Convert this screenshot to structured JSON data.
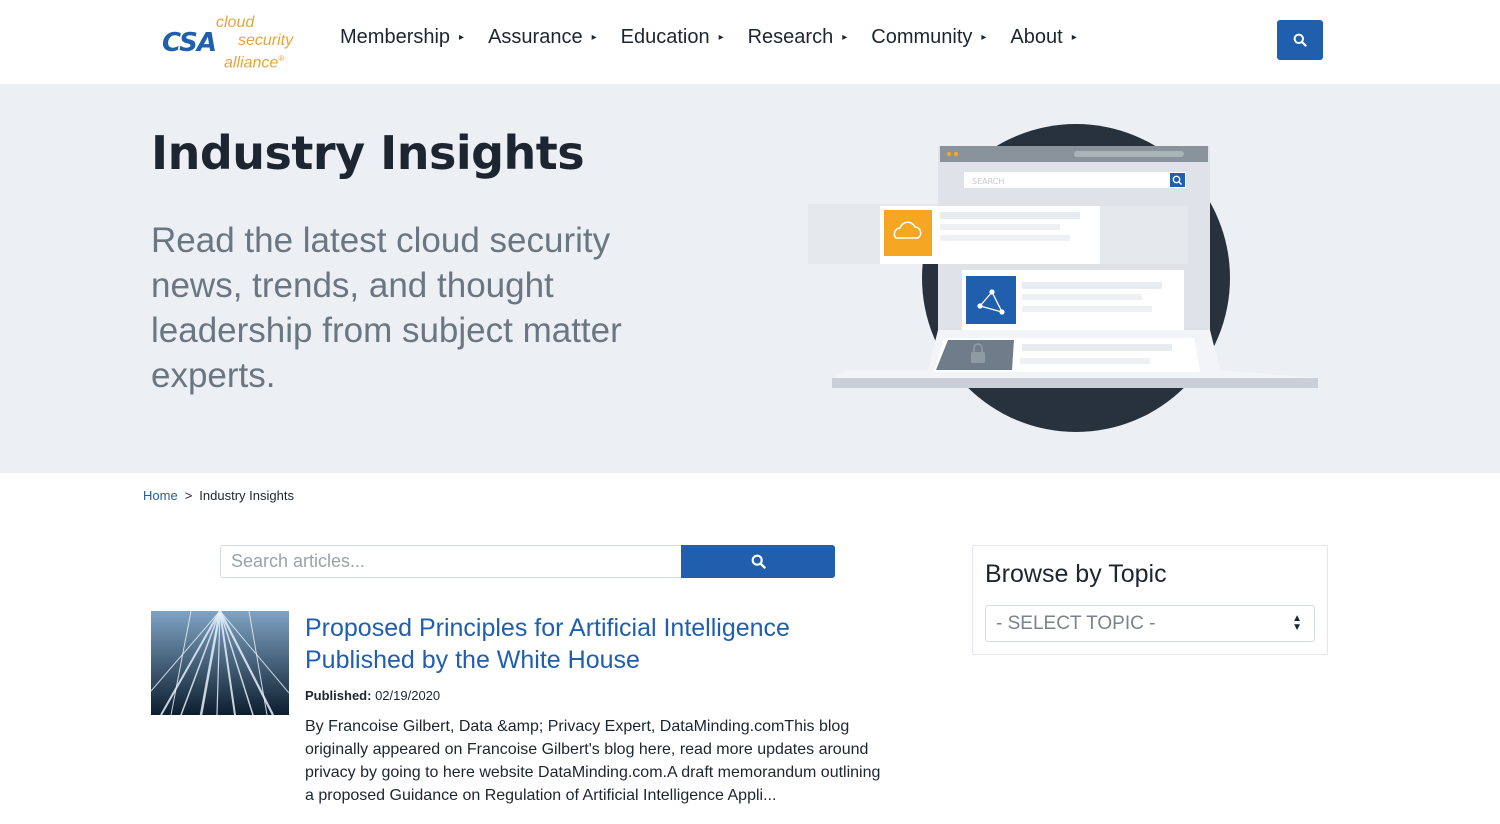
{
  "logo": {
    "mark": "CSA",
    "words": [
      "cloud",
      "security",
      "alliance"
    ],
    "registered": "®",
    "colors": {
      "mark": "#1f5fae",
      "words": "#e8a33a"
    }
  },
  "nav": {
    "items": [
      {
        "label": "Membership"
      },
      {
        "label": "Assurance"
      },
      {
        "label": "Education"
      },
      {
        "label": "Research"
      },
      {
        "label": "Community"
      },
      {
        "label": "About"
      }
    ],
    "caret": "▸",
    "search_icon": "search-icon"
  },
  "hero": {
    "title": "Industry Insights",
    "subtitle": "Read the latest cloud security news, trends, and thought leadership from subject matter experts.",
    "illustration": {
      "search_placeholder": "SEARCH",
      "icons": [
        "cloud-icon",
        "network-icon",
        "lock-icon"
      ]
    }
  },
  "breadcrumb": {
    "home": "Home",
    "separator": ">",
    "current": "Industry Insights"
  },
  "article_search": {
    "placeholder": "Search articles...",
    "button_icon": "search-icon"
  },
  "article": {
    "title": "Proposed Principles for Artificial Intelligence Published by the White House",
    "published_label": "Published:",
    "published_date": "02/19/2020",
    "excerpt": "By Francoise Gilbert, Data &amp; Privacy Expert, DataMinding.comThis blog originally appeared on Francoise Gilbert's blog here, read more updates around privacy by going to here website DataMinding.com.A draft memorandum outlining a proposed Guidance on Regulation of Artificial Intelligence Appli..."
  },
  "sidebar": {
    "title": "Browse by Topic",
    "select_value": "- SELECT TOPIC -"
  },
  "colors": {
    "brand_blue": "#1f5fae",
    "hero_bg": "#eceff4",
    "accent_orange": "#f5a623",
    "text_dark": "#1d2530",
    "text_gray": "#6a7680"
  }
}
